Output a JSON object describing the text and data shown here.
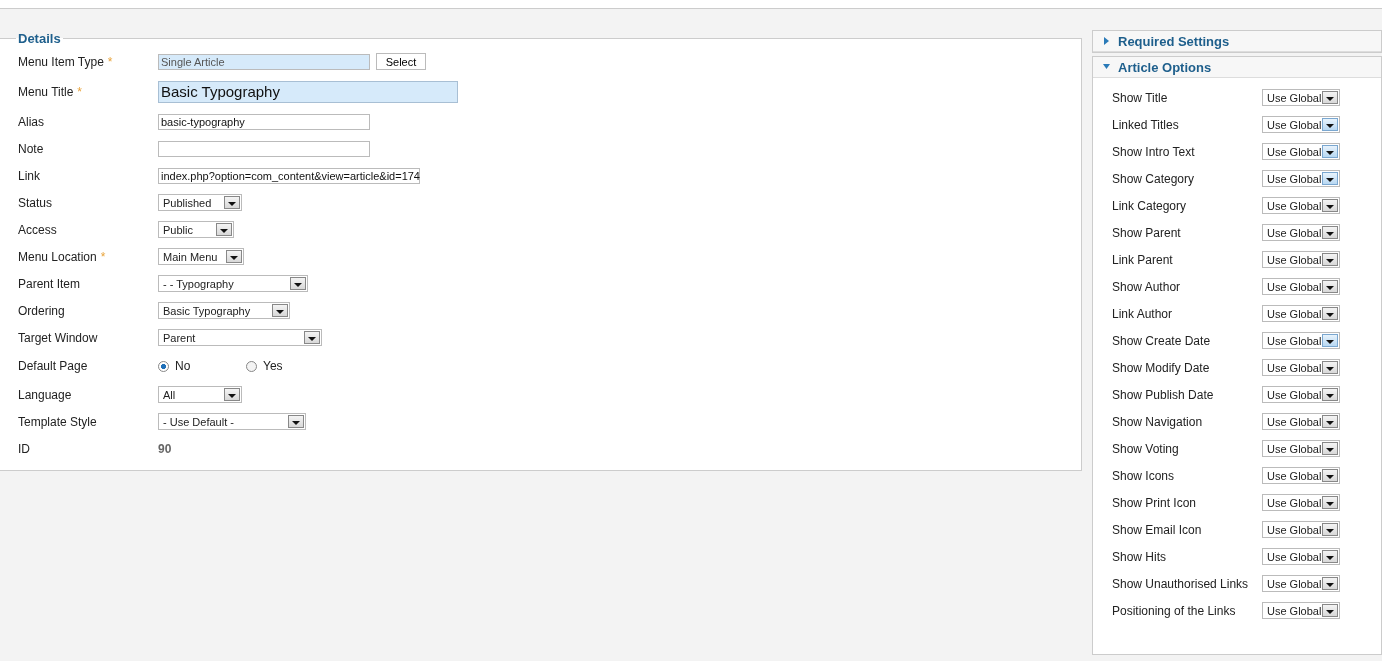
{
  "details": {
    "legend": "Details",
    "fields": [
      {
        "kind": "type",
        "label": "Menu Item Type",
        "marker": "*",
        "value": "Single Article",
        "button": "Select"
      },
      {
        "kind": "title",
        "label": "Menu Title",
        "marker": "*",
        "value": "Basic Typography"
      },
      {
        "kind": "text",
        "label": "Alias",
        "value": "basic-typography"
      },
      {
        "kind": "text",
        "label": "Note"
      },
      {
        "kind": "link",
        "label": "Link",
        "value": "index.php?option=com_content&view=article&id=174"
      },
      {
        "kind": "select",
        "label": "Status",
        "value": "Published"
      },
      {
        "kind": "select",
        "label": "Access",
        "value": "Public"
      },
      {
        "kind": "select",
        "label": "Menu Location",
        "marker": "*",
        "value": "Main Menu"
      },
      {
        "kind": "select",
        "label": "Parent Item",
        "value": "- - Typography"
      },
      {
        "kind": "select",
        "label": "Ordering",
        "value": "Basic Typography"
      },
      {
        "kind": "select",
        "label": "Target Window",
        "value": "Parent"
      },
      {
        "kind": "radio",
        "label": "Default Page",
        "options": [
          {
            "label": "No",
            "selected": true
          },
          {
            "label": "Yes",
            "selected": false
          }
        ]
      },
      {
        "kind": "select",
        "label": "Language",
        "value": "All"
      },
      {
        "kind": "select",
        "label": "Template Style",
        "value": "- Use Default -"
      },
      {
        "kind": "static",
        "label": "ID",
        "value": "90"
      }
    ]
  },
  "sections": [
    {
      "title": "Required Settings",
      "expanded": false
    },
    {
      "title": "Article Options",
      "expanded": true,
      "options": [
        {
          "label": "Show Title",
          "value": "Use Global",
          "hovered": false
        },
        {
          "label": "Linked Titles",
          "value": "Use Global",
          "hovered": true
        },
        {
          "label": "Show Intro Text",
          "value": "Use Global",
          "hovered": true
        },
        {
          "label": "Show Category",
          "value": "Use Global",
          "hovered": true
        },
        {
          "label": "Link Category",
          "value": "Use Global",
          "hovered": false
        },
        {
          "label": "Show Parent",
          "value": "Use Global",
          "hovered": false
        },
        {
          "label": "Link Parent",
          "value": "Use Global",
          "hovered": false
        },
        {
          "label": "Show Author",
          "value": "Use Global",
          "hovered": false
        },
        {
          "label": "Link Author",
          "value": "Use Global",
          "hovered": false
        },
        {
          "label": "Show Create Date",
          "value": "Use Global",
          "hovered": true
        },
        {
          "label": "Show Modify Date",
          "value": "Use Global",
          "hovered": false
        },
        {
          "label": "Show Publish Date",
          "value": "Use Global",
          "hovered": false
        },
        {
          "label": "Show Navigation",
          "value": "Use Global",
          "hovered": false
        },
        {
          "label": "Show Voting",
          "value": "Use Global",
          "hovered": false
        },
        {
          "label": "Show Icons",
          "value": "Use Global",
          "hovered": false
        },
        {
          "label": "Show Print Icon",
          "value": "Use Global",
          "hovered": false
        },
        {
          "label": "Show Email Icon",
          "value": "Use Global",
          "hovered": false
        },
        {
          "label": "Show Hits",
          "value": "Use Global",
          "hovered": false
        },
        {
          "label": "Show Unauthorised Links",
          "value": "Use Global",
          "hovered": false
        },
        {
          "label": "Positioning of the Links",
          "value": "Use Global",
          "hovered": false
        }
      ]
    }
  ]
}
